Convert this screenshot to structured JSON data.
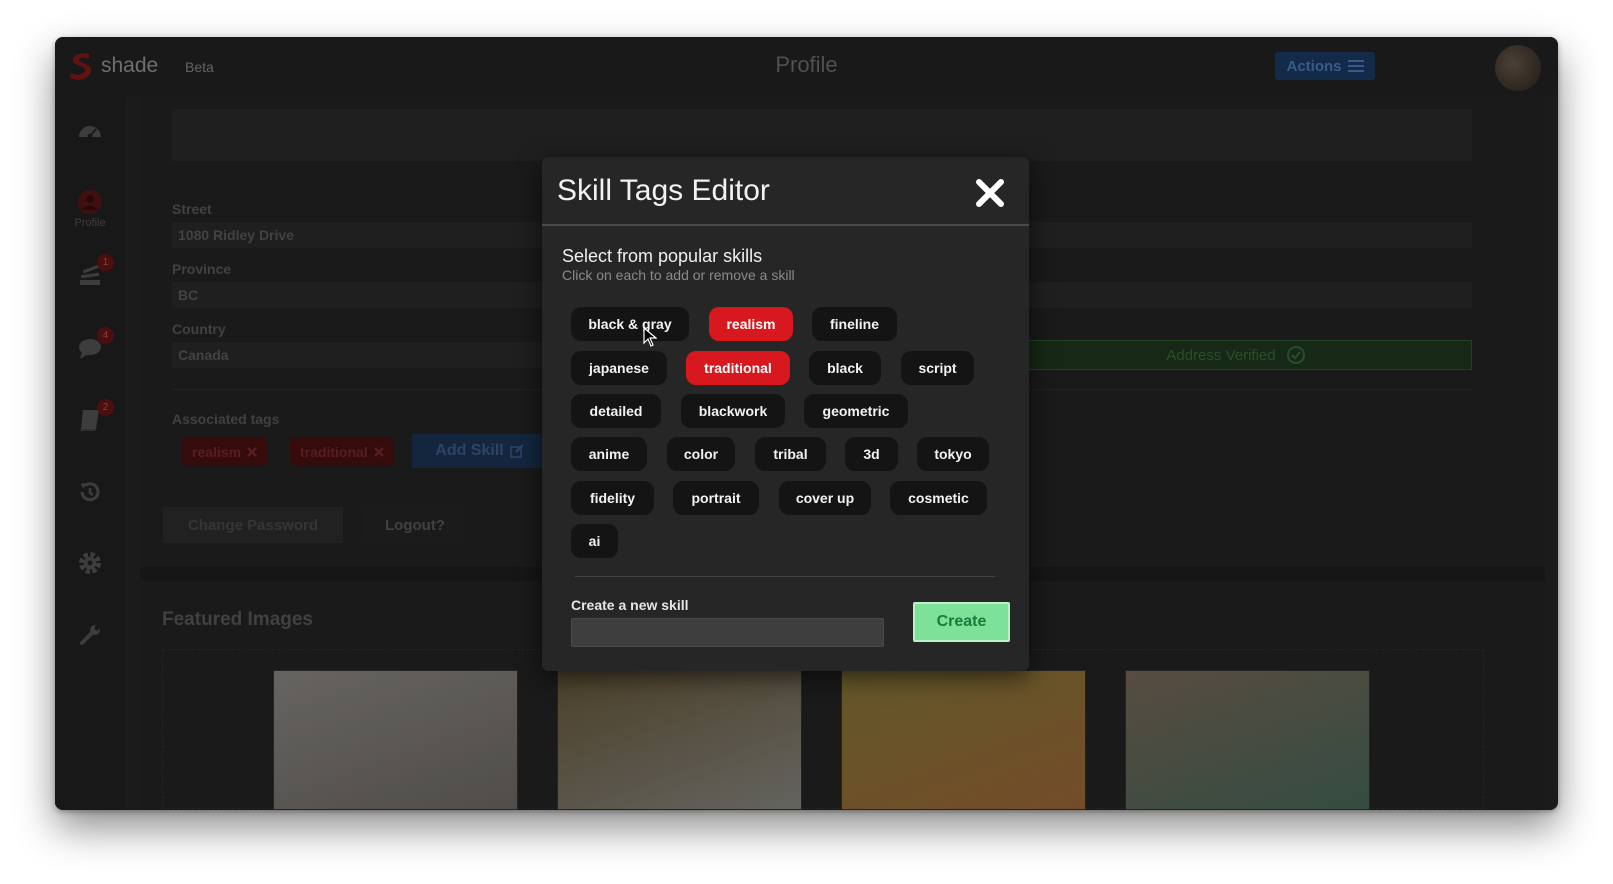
{
  "app": {
    "brand": "shade",
    "beta_label": "Beta",
    "page_title": "Profile",
    "actions_label": "Actions"
  },
  "sidebar": {
    "profile_label": "Profile",
    "badges": {
      "feed": "1",
      "messages": "4",
      "book": "2"
    }
  },
  "form": {
    "street_label": "Street",
    "street_value": "1080 Ridley Drive",
    "province_label": "Province",
    "province_value": "BC",
    "country_label": "Country",
    "country_value": "Canada",
    "address_verified": "Address Verified",
    "tags_label": "Associated tags",
    "tags": [
      "realism",
      "traditional"
    ],
    "add_skill": "Add Skill",
    "change_password": "Change Password",
    "logout": "Logout?"
  },
  "featured": {
    "title": "Featured Images"
  },
  "modal": {
    "title": "Skill Tags Editor",
    "select_title": "Select from popular skills",
    "select_subtitle": "Click on each to add or remove a skill",
    "skills": [
      {
        "label": "black & gray",
        "selected": false
      },
      {
        "label": "realism",
        "selected": true
      },
      {
        "label": "fineline",
        "selected": false
      },
      {
        "label": "japanese",
        "selected": false
      },
      {
        "label": "traditional",
        "selected": true
      },
      {
        "label": "black",
        "selected": false
      },
      {
        "label": "script",
        "selected": false
      },
      {
        "label": "detailed",
        "selected": false
      },
      {
        "label": "blackwork",
        "selected": false
      },
      {
        "label": "geometric",
        "selected": false
      },
      {
        "label": "anime",
        "selected": false
      },
      {
        "label": "color",
        "selected": false
      },
      {
        "label": "tribal",
        "selected": false
      },
      {
        "label": "3d",
        "selected": false
      },
      {
        "label": "tokyo",
        "selected": false
      },
      {
        "label": "fidelity",
        "selected": false
      },
      {
        "label": "portrait",
        "selected": false
      },
      {
        "label": "cover up",
        "selected": false
      },
      {
        "label": "cosmetic",
        "selected": false
      },
      {
        "label": "ai",
        "selected": false
      }
    ],
    "new_skill_label": "Create a new skill",
    "new_skill_value": "",
    "create_label": "Create"
  },
  "colors": {
    "selected_chip": "#d8181f",
    "chip": "#141414",
    "create_button": "#7de19a"
  }
}
